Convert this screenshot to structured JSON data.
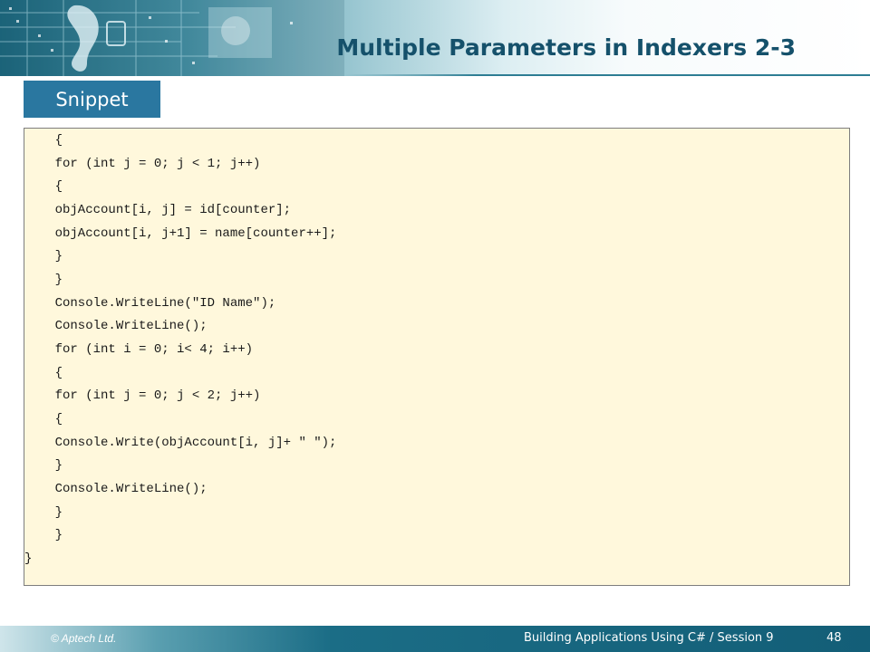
{
  "slide": {
    "title": "Multiple Parameters in Indexers 2-3",
    "snippet_label": "Snippet"
  },
  "code": {
    "lines": [
      "    {",
      "    for (int j = 0; j < 1; j++)",
      "    {",
      "    objAccount[i, j] = id[counter];",
      "    objAccount[i, j+1] = name[counter++];",
      "    }",
      "    }",
      "    Console.WriteLine(\"ID Name\");",
      "    Console.WriteLine();",
      "    for (int i = 0; i< 4; i++)",
      "    {",
      "    for (int j = 0; j < 2; j++)",
      "    {",
      "    Console.Write(objAccount[i, j]+ \" \");",
      "    }",
      "    Console.WriteLine();",
      "    }",
      "    }",
      "}"
    ]
  },
  "footer": {
    "copyright": "© Aptech Ltd.",
    "course": "Building Applications Using C# / Session 9",
    "page_number": "48"
  },
  "theme": {
    "accent": "#2a77a0",
    "title_color": "#15516b",
    "code_background": "#fff8dc"
  }
}
